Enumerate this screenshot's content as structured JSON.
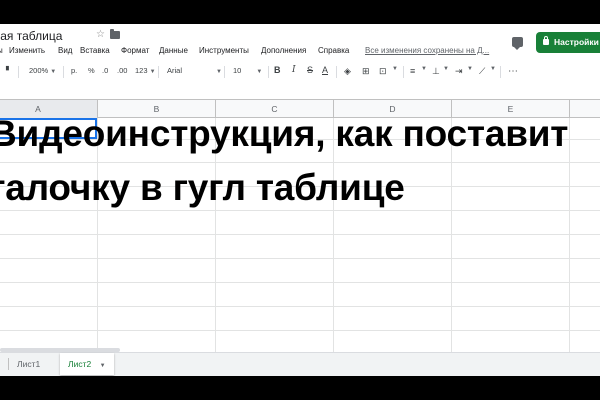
{
  "header": {
    "doc_title": "вая таблица",
    "saved_status": "Все изменения сохранены на Д...",
    "settings_label": "Настройки"
  },
  "menu": [
    "Вид",
    "Изменить",
    "Вставка",
    "Формат",
    "Данные",
    "Инструменты",
    "Дополнения",
    "Справка"
  ],
  "menu_file_partial": "ы",
  "toolbar": {
    "zoom": "200%",
    "currency": "р.",
    "percent": "%",
    "dec_less": ".0",
    "dec_more": ".00",
    "format_more": "123",
    "font": "Arial",
    "font_size": "10",
    "bold": "B",
    "italic": "I",
    "strike": "S",
    "text_color": "A",
    "more": "⋯"
  },
  "columns": [
    "A",
    "B",
    "C",
    "D",
    "E"
  ],
  "overlay_text": {
    "line1": "Видеоинструкция, как поставит",
    "line2": "галочку в гугл таблице"
  },
  "sheets": [
    {
      "label": "Лист1",
      "active": false
    },
    {
      "label": "Лист2",
      "active": true
    }
  ],
  "colors": {
    "accent_green": "#188038",
    "selection_blue": "#1a73e8"
  }
}
